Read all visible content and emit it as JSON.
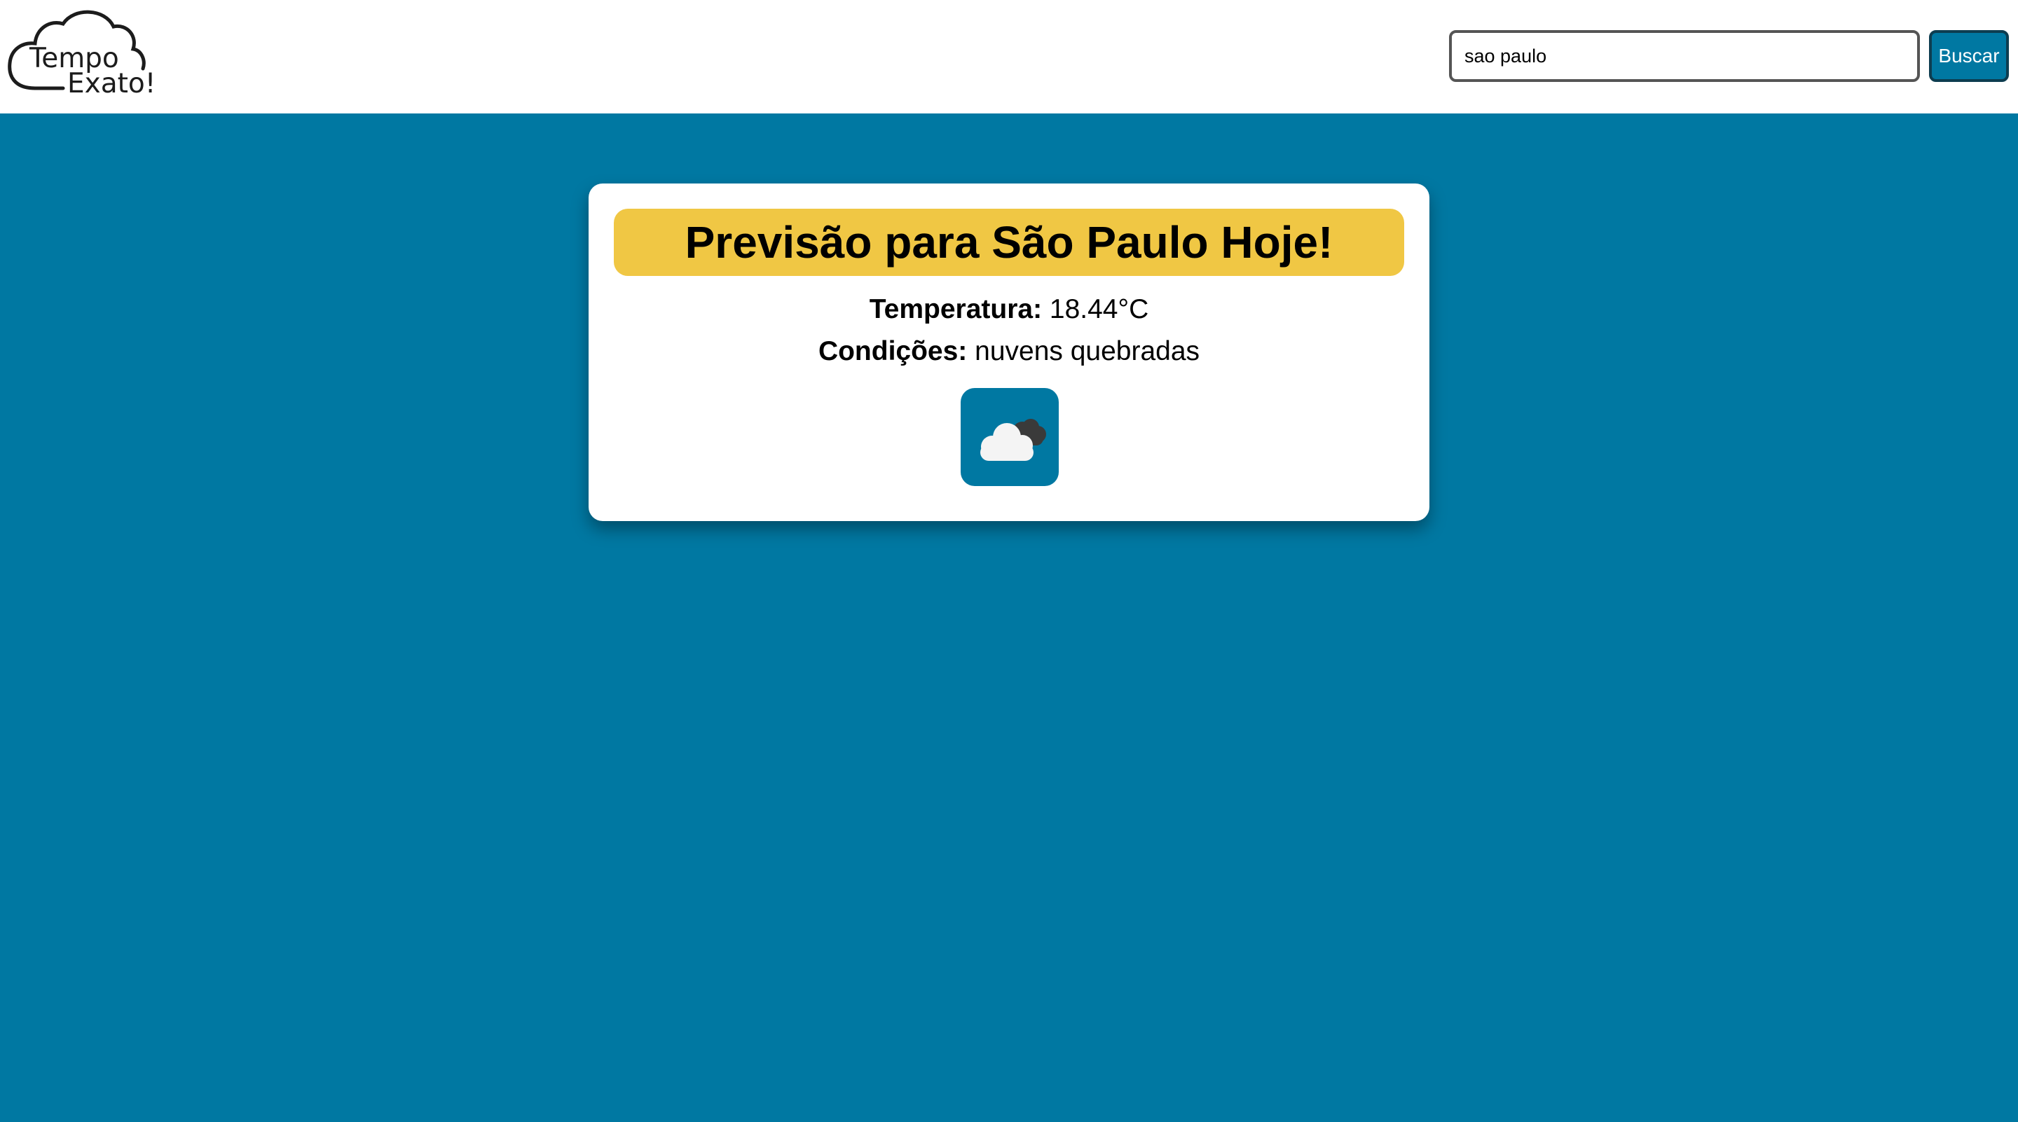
{
  "header": {
    "logo": {
      "line1": "Tempo",
      "line2": "Exato!"
    },
    "search": {
      "value": "sao paulo",
      "placeholder": ""
    },
    "search_button_label": "Buscar"
  },
  "forecast": {
    "title": "Previsão para São Paulo Hoje!",
    "temperature_label": "Temperatura:",
    "temperature_value": "18.44°C",
    "conditions_label": "Condições:",
    "conditions_value": "nuvens quebradas",
    "icon": "broken-clouds-icon"
  },
  "colors": {
    "background": "#0078a2",
    "title_highlight": "#f0c744",
    "header": "#ffffff"
  }
}
